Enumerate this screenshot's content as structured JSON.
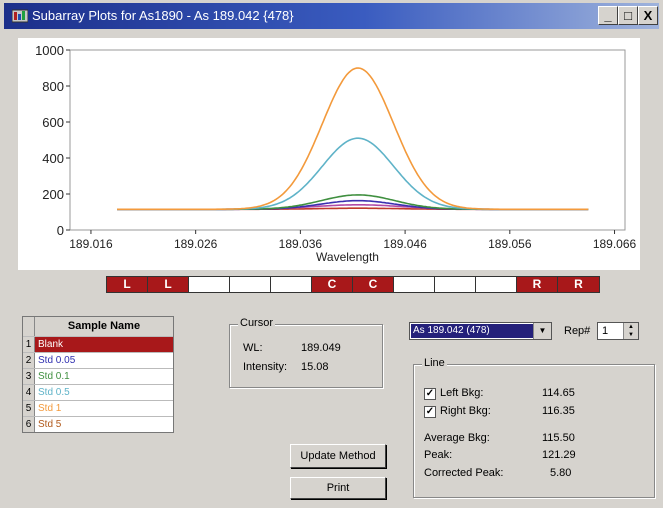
{
  "window": {
    "title": "Subarray Plots for As1890 - As 189.042 {478}",
    "minimize_glyph": "_",
    "maximize_glyph": "□",
    "close_glyph": "X"
  },
  "chart_data": {
    "type": "line",
    "xlabel": "Wavelength",
    "xlim": [
      189.014,
      189.067
    ],
    "ylim": [
      0,
      1000
    ],
    "x_ticks": [
      "189.016",
      "189.026",
      "189.036",
      "189.046",
      "189.056",
      "189.066"
    ],
    "y_ticks": [
      "0",
      "200",
      "400",
      "600",
      "800",
      "1000"
    ],
    "grid": false,
    "series": [
      {
        "key": "blank",
        "color": "#c0392b",
        "baseline": 115,
        "peak_height": 6,
        "center": 189.0415,
        "width": 0.0038
      },
      {
        "key": "std005",
        "color": "#3b2fb0",
        "baseline": 115,
        "peak_height": 48,
        "center": 189.0415,
        "width": 0.0035
      },
      {
        "key": "std01",
        "color": "#3f8f3f",
        "baseline": 115,
        "peak_height": 80,
        "center": 189.0415,
        "width": 0.0035
      },
      {
        "key": "std05",
        "color": "#b04aa8",
        "baseline": 115,
        "peak_height": 25,
        "center": 189.0415,
        "width": 0.0042
      },
      {
        "key": "std1",
        "color": "#5fb3c8",
        "baseline": 115,
        "peak_height": 395,
        "center": 189.0415,
        "width": 0.0034
      },
      {
        "key": "std5",
        "color": "#f39a3c",
        "baseline": 115,
        "peak_height": 785,
        "center": 189.0415,
        "width": 0.0034
      }
    ]
  },
  "bkg_bar": {
    "segments": [
      {
        "label": "L",
        "state": "red"
      },
      {
        "label": "L",
        "state": "red"
      },
      {
        "label": "",
        "state": "white"
      },
      {
        "label": "",
        "state": "white"
      },
      {
        "label": "",
        "state": "white"
      },
      {
        "label": "C",
        "state": "red"
      },
      {
        "label": "C",
        "state": "red"
      },
      {
        "label": "",
        "state": "white"
      },
      {
        "label": "",
        "state": "white"
      },
      {
        "label": "",
        "state": "white"
      },
      {
        "label": "R",
        "state": "red"
      },
      {
        "label": "R",
        "state": "red"
      }
    ]
  },
  "samples": {
    "header": "Sample Name",
    "rows": [
      {
        "num": "1",
        "name": "Blank",
        "color": "#ffffff",
        "bg": "#a8181a"
      },
      {
        "num": "2",
        "name": "Std 0.05",
        "color": "#2f2fb0",
        "bg": "#ffffff"
      },
      {
        "num": "3",
        "name": "Std 0.1",
        "color": "#3f8f3f",
        "bg": "#ffffff"
      },
      {
        "num": "4",
        "name": "Std 0.5",
        "color": "#5fb3c8",
        "bg": "#ffffff"
      },
      {
        "num": "5",
        "name": "Std 1",
        "color": "#f39a3c",
        "bg": "#ffffff"
      },
      {
        "num": "6",
        "name": "Std 5",
        "color": "#b0581a",
        "bg": "#ffffff"
      }
    ]
  },
  "cursor": {
    "label": "Cursor",
    "wl_label": "WL:",
    "wl_value": "189.049",
    "intensity_label": "Intensity:",
    "intensity_value": "15.08"
  },
  "line_select": {
    "value": "As 189.042 (478)",
    "arrow": "▼"
  },
  "rep": {
    "label": "Rep#",
    "value": "1"
  },
  "line_group": {
    "label": "Line",
    "left_bkg_label": "Left Bkg:",
    "left_bkg_value": "114.65",
    "left_checked": true,
    "right_bkg_label": "Right Bkg:",
    "right_bkg_value": "116.35",
    "right_checked": true,
    "avg_label": "Average Bkg:",
    "avg_value": "115.50",
    "peak_label": "Peak:",
    "peak_value": "121.29",
    "corr_label": "Corrected Peak:",
    "corr_value": "5.80"
  },
  "buttons": {
    "update": "Update Method",
    "print": "Print"
  }
}
